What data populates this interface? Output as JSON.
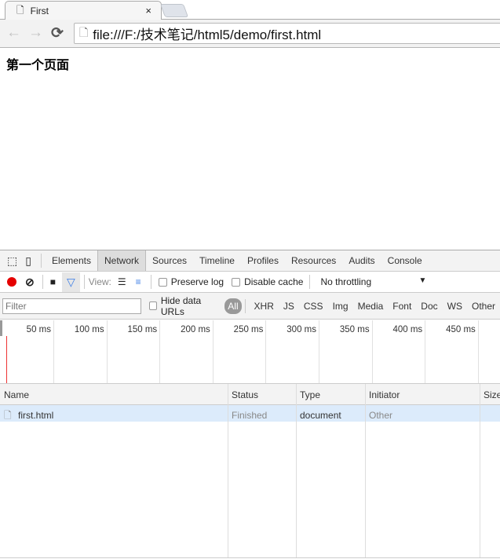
{
  "browser": {
    "tab_title": "First",
    "close": "×",
    "back": "←",
    "forward": "→",
    "reload": "⟳",
    "url": "file:///F:/技术笔记/html5/demo/first.html"
  },
  "page": {
    "heading": "第一个页面"
  },
  "devtools": {
    "tabs": [
      "Elements",
      "Network",
      "Sources",
      "Timeline",
      "Profiles",
      "Resources",
      "Audits",
      "Console"
    ],
    "selected_tab": "Network",
    "view_label": "View:",
    "preserve_log": "Preserve log",
    "preserve_log_checked": false,
    "disable_cache": "Disable cache",
    "disable_cache_checked": false,
    "throttling": "No throttling",
    "filter_placeholder": "Filter",
    "hide_data_urls": "Hide data URLs",
    "filters": [
      "All",
      "XHR",
      "JS",
      "CSS",
      "Img",
      "Media",
      "Font",
      "Doc",
      "WS",
      "Other"
    ],
    "selected_filter": "All",
    "timeline_ticks": [
      "50 ms",
      "100 ms",
      "150 ms",
      "200 ms",
      "250 ms",
      "300 ms",
      "350 ms",
      "400 ms",
      "450 ms"
    ],
    "columns": [
      "Name",
      "Status",
      "Type",
      "Initiator",
      "Size"
    ],
    "rows": [
      {
        "name": "first.html",
        "status": "Finished",
        "type": "document",
        "initiator": "Other"
      }
    ],
    "colors": {
      "record": "#e50000",
      "filter_active": "#3b7de6",
      "row_selected": "#dcebfb"
    }
  }
}
